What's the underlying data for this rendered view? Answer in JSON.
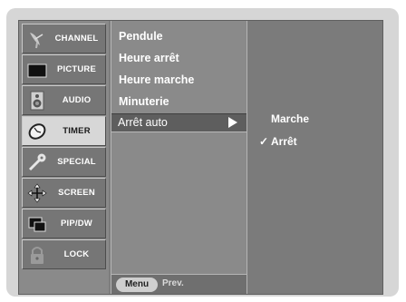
{
  "sidebar": {
    "items": [
      {
        "label": "CHANNEL",
        "icon": "satellite-dish-icon"
      },
      {
        "label": "PICTURE",
        "icon": "monitor-icon"
      },
      {
        "label": "AUDIO",
        "icon": "speaker-icon"
      },
      {
        "label": "TIMER",
        "icon": "clock-icon"
      },
      {
        "label": "SPECIAL",
        "icon": "key-icon"
      },
      {
        "label": "SCREEN",
        "icon": "move-arrows-icon"
      },
      {
        "label": "PIP/DW",
        "icon": "pip-windows-icon"
      },
      {
        "label": "LOCK",
        "icon": "padlock-icon"
      }
    ],
    "active": "TIMER"
  },
  "menu": {
    "items": [
      "Pendule",
      "Heure arrêt",
      "Heure marche",
      "Minuterie"
    ],
    "selected": "Arrêt auto",
    "footer": {
      "button": "Menu",
      "prev": "Prev."
    }
  },
  "submenu": {
    "options": [
      "Marche",
      "Arrêt"
    ],
    "checked_mark": "✓"
  }
}
